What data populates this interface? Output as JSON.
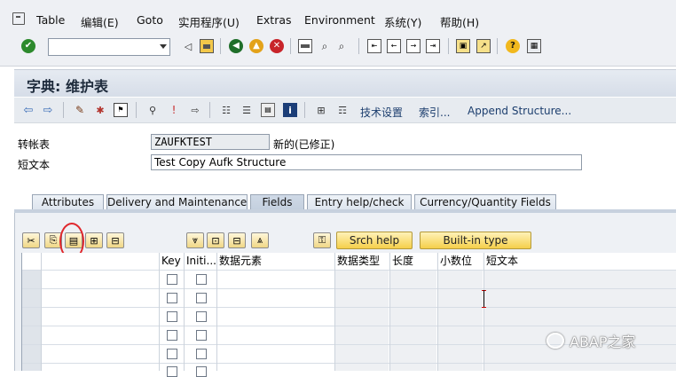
{
  "menubar": {
    "items": [
      "Table",
      "编辑(E)",
      "Goto",
      "实用程序(U)",
      "Extras",
      "Environment",
      "系统(Y)",
      "帮助(H)"
    ]
  },
  "stdbar": {
    "command_value": "",
    "icons": [
      "enter-icon",
      "back-icon",
      "save-icon",
      "back-nav-icon",
      "exit-icon",
      "cancel-icon",
      "print-icon",
      "find-icon",
      "find-next-icon",
      "first-page-icon",
      "prev-page-icon",
      "next-page-icon",
      "last-page-icon",
      "new-session-icon",
      "shortcut-icon",
      "help-icon",
      "layout-icon"
    ]
  },
  "title": "字典: 维护表",
  "appbar": {
    "tech_settings": "技术设置",
    "indexes": "索引...",
    "append_structure": "Append Structure..."
  },
  "header": {
    "table_label": "转帐表",
    "table_name": "ZAUFKTEST",
    "status": "新的(已修正)",
    "short_text_label": "短文本",
    "short_text": "Test Copy Aufk Structure"
  },
  "tabs": [
    {
      "label": "Attributes",
      "active": false
    },
    {
      "label": "Delivery and Maintenance",
      "active": false
    },
    {
      "label": "Fields",
      "active": true
    },
    {
      "label": "Entry help/check",
      "active": false
    },
    {
      "label": "Currency/Quantity Fields",
      "active": false
    }
  ],
  "table_toolbar": {
    "srch_help": "Srch help",
    "built_in_type": "Built-in type"
  },
  "grid": {
    "columns": [
      "",
      "Key",
      "Initi...",
      "数据元素",
      "数据类型",
      "长度",
      "小数位",
      "短文本"
    ],
    "rows": 6
  },
  "watermark": "ABAP之家"
}
